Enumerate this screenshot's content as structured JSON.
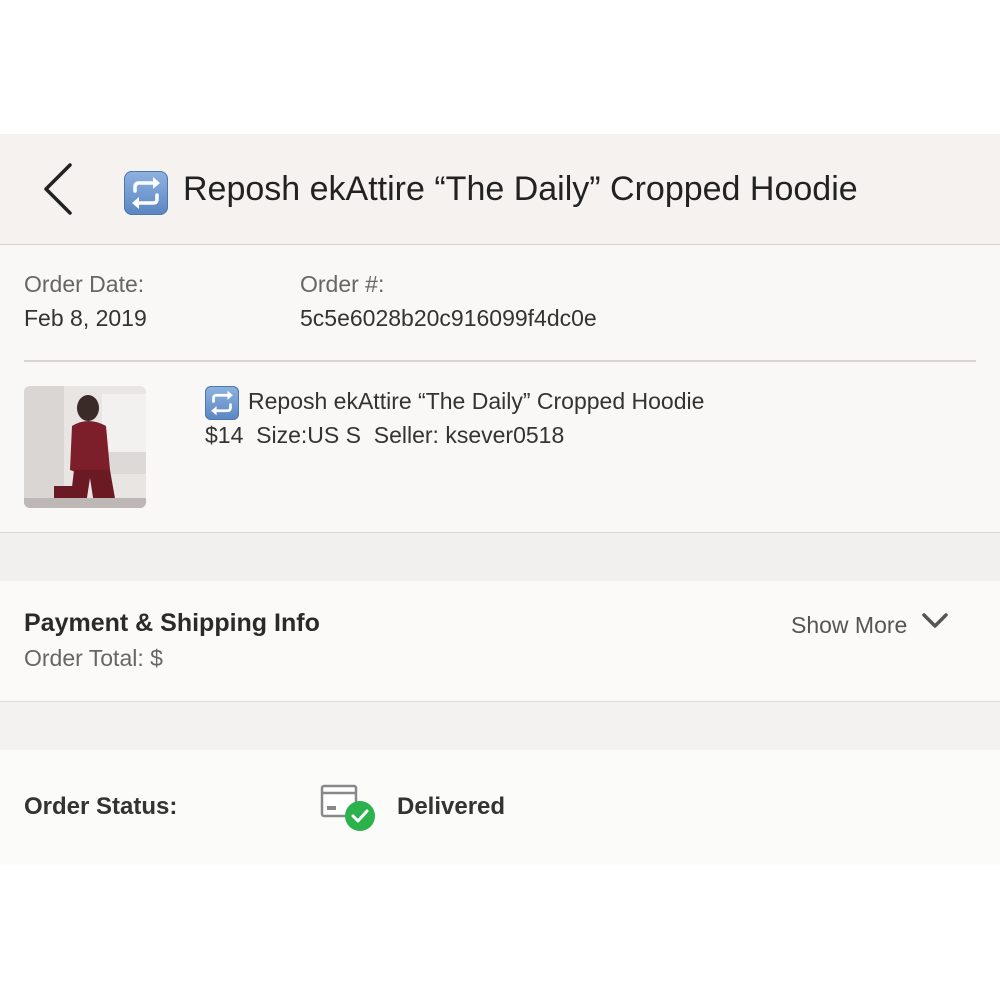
{
  "header": {
    "title": "Reposh ekAttire “The Daily” Cropped Hoodie",
    "icons": [
      "back-icon",
      "repost-icon"
    ]
  },
  "order": {
    "date_label": "Order Date:",
    "date_value": "Feb 8, 2019",
    "number_label": "Order #:",
    "number_value": "5c5e6028b20c916099f4dc0e"
  },
  "item": {
    "title": "Reposh ekAttire “The Daily” Cropped Hoodie",
    "meta": "$14  Size:US S  Seller: ksever0518",
    "thumbnail_icon": "product-photo"
  },
  "payment": {
    "title": "Payment & Shipping Info",
    "total_label": "Order Total: $",
    "show_more_label": "Show More",
    "show_more_icon": "chevron-down-icon"
  },
  "status": {
    "label": "Order Status:",
    "value": "Delivered",
    "icon": "package-delivered-icon",
    "check_color": "#2bb24c"
  },
  "colors": {
    "header_bg": "#f5f2ef",
    "repost_blue": "#6a93cc",
    "text_primary": "#222222",
    "text_secondary": "#666666"
  }
}
